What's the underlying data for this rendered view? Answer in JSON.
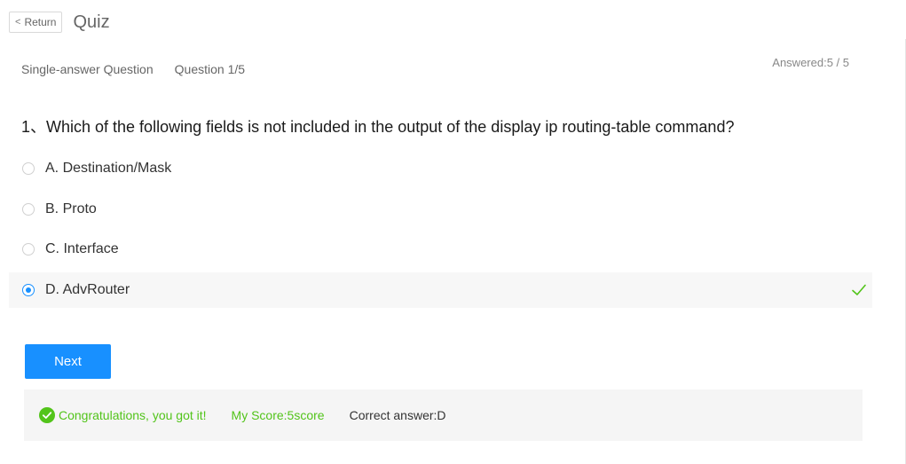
{
  "header": {
    "return_label": "Return",
    "return_icon": "chevron-left-icon",
    "title": "Quiz"
  },
  "meta": {
    "question_type": "Single-answer Question",
    "question_index": "Question 1/5",
    "answered": "Answered:5 / 5"
  },
  "question": {
    "text": "1、Which of the following fields is not included in the output of the display ip routing-table command?",
    "options": [
      {
        "label": "A. Destination/Mask",
        "selected": false
      },
      {
        "label": "B. Proto",
        "selected": false
      },
      {
        "label": "C. Interface",
        "selected": false
      },
      {
        "label": "D. AdvRouter",
        "selected": true,
        "correct_mark": "check-icon"
      }
    ]
  },
  "actions": {
    "next_label": "Next"
  },
  "result": {
    "congrats": "Congratulations, you got it!",
    "score": "My Score:5score",
    "correct_answer": "Correct answer:D",
    "success_color": "#52c41a"
  },
  "colors": {
    "accent": "#1890ff",
    "success": "#52c41a"
  }
}
